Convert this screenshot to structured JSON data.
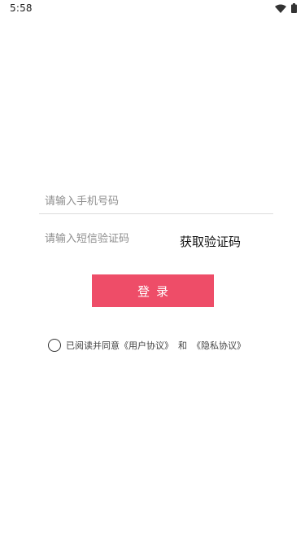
{
  "status_bar": {
    "time": "5:58",
    "icons": [
      "wifi-icon",
      "battery-icon"
    ]
  },
  "login_form": {
    "phone_placeholder": "请输入手机号码",
    "code_placeholder": "请输入短信验证码",
    "get_code_label": "获取验证码",
    "login_label": "登录"
  },
  "agreement": {
    "prefix": "已阅读并同意",
    "user_agreement": "《用户协议》",
    "and": "和",
    "privacy_policy": "《隐私协议》",
    "checked": false
  },
  "colors": {
    "accent": "#ee4d68",
    "background": "#ffffff",
    "divider": "#dcdcdc"
  }
}
